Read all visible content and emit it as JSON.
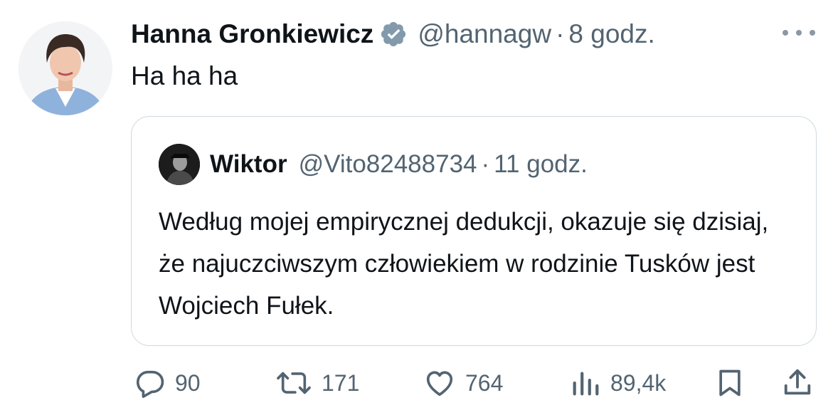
{
  "tweet": {
    "author_name": "Hanna Gronkiewicz",
    "verified_badge_icon": "verified-badge-icon",
    "handle": "@hannagw",
    "separator": "·",
    "time": "8 godz.",
    "text": "Ha ha ha"
  },
  "quoted": {
    "author_name": "Wiktor",
    "handle": "@Vito82488734",
    "separator": "·",
    "time": "11 godz.",
    "text": "Według mojej empirycznej dedukcji, okazuje się dzisiaj, że najuczciwszym człowiekiem w rodzinie Tusków jest Wojciech Fułek."
  },
  "actions": {
    "replies": "90",
    "reposts": "171",
    "likes": "764",
    "views": "89,4k"
  },
  "colors": {
    "text": "#0f1419",
    "muted": "#536471",
    "border": "#cfd9de",
    "badge": "#829aab"
  },
  "icons": [
    "more-icon",
    "reply-icon",
    "repost-icon",
    "like-icon",
    "views-icon",
    "bookmark-icon",
    "share-icon"
  ]
}
